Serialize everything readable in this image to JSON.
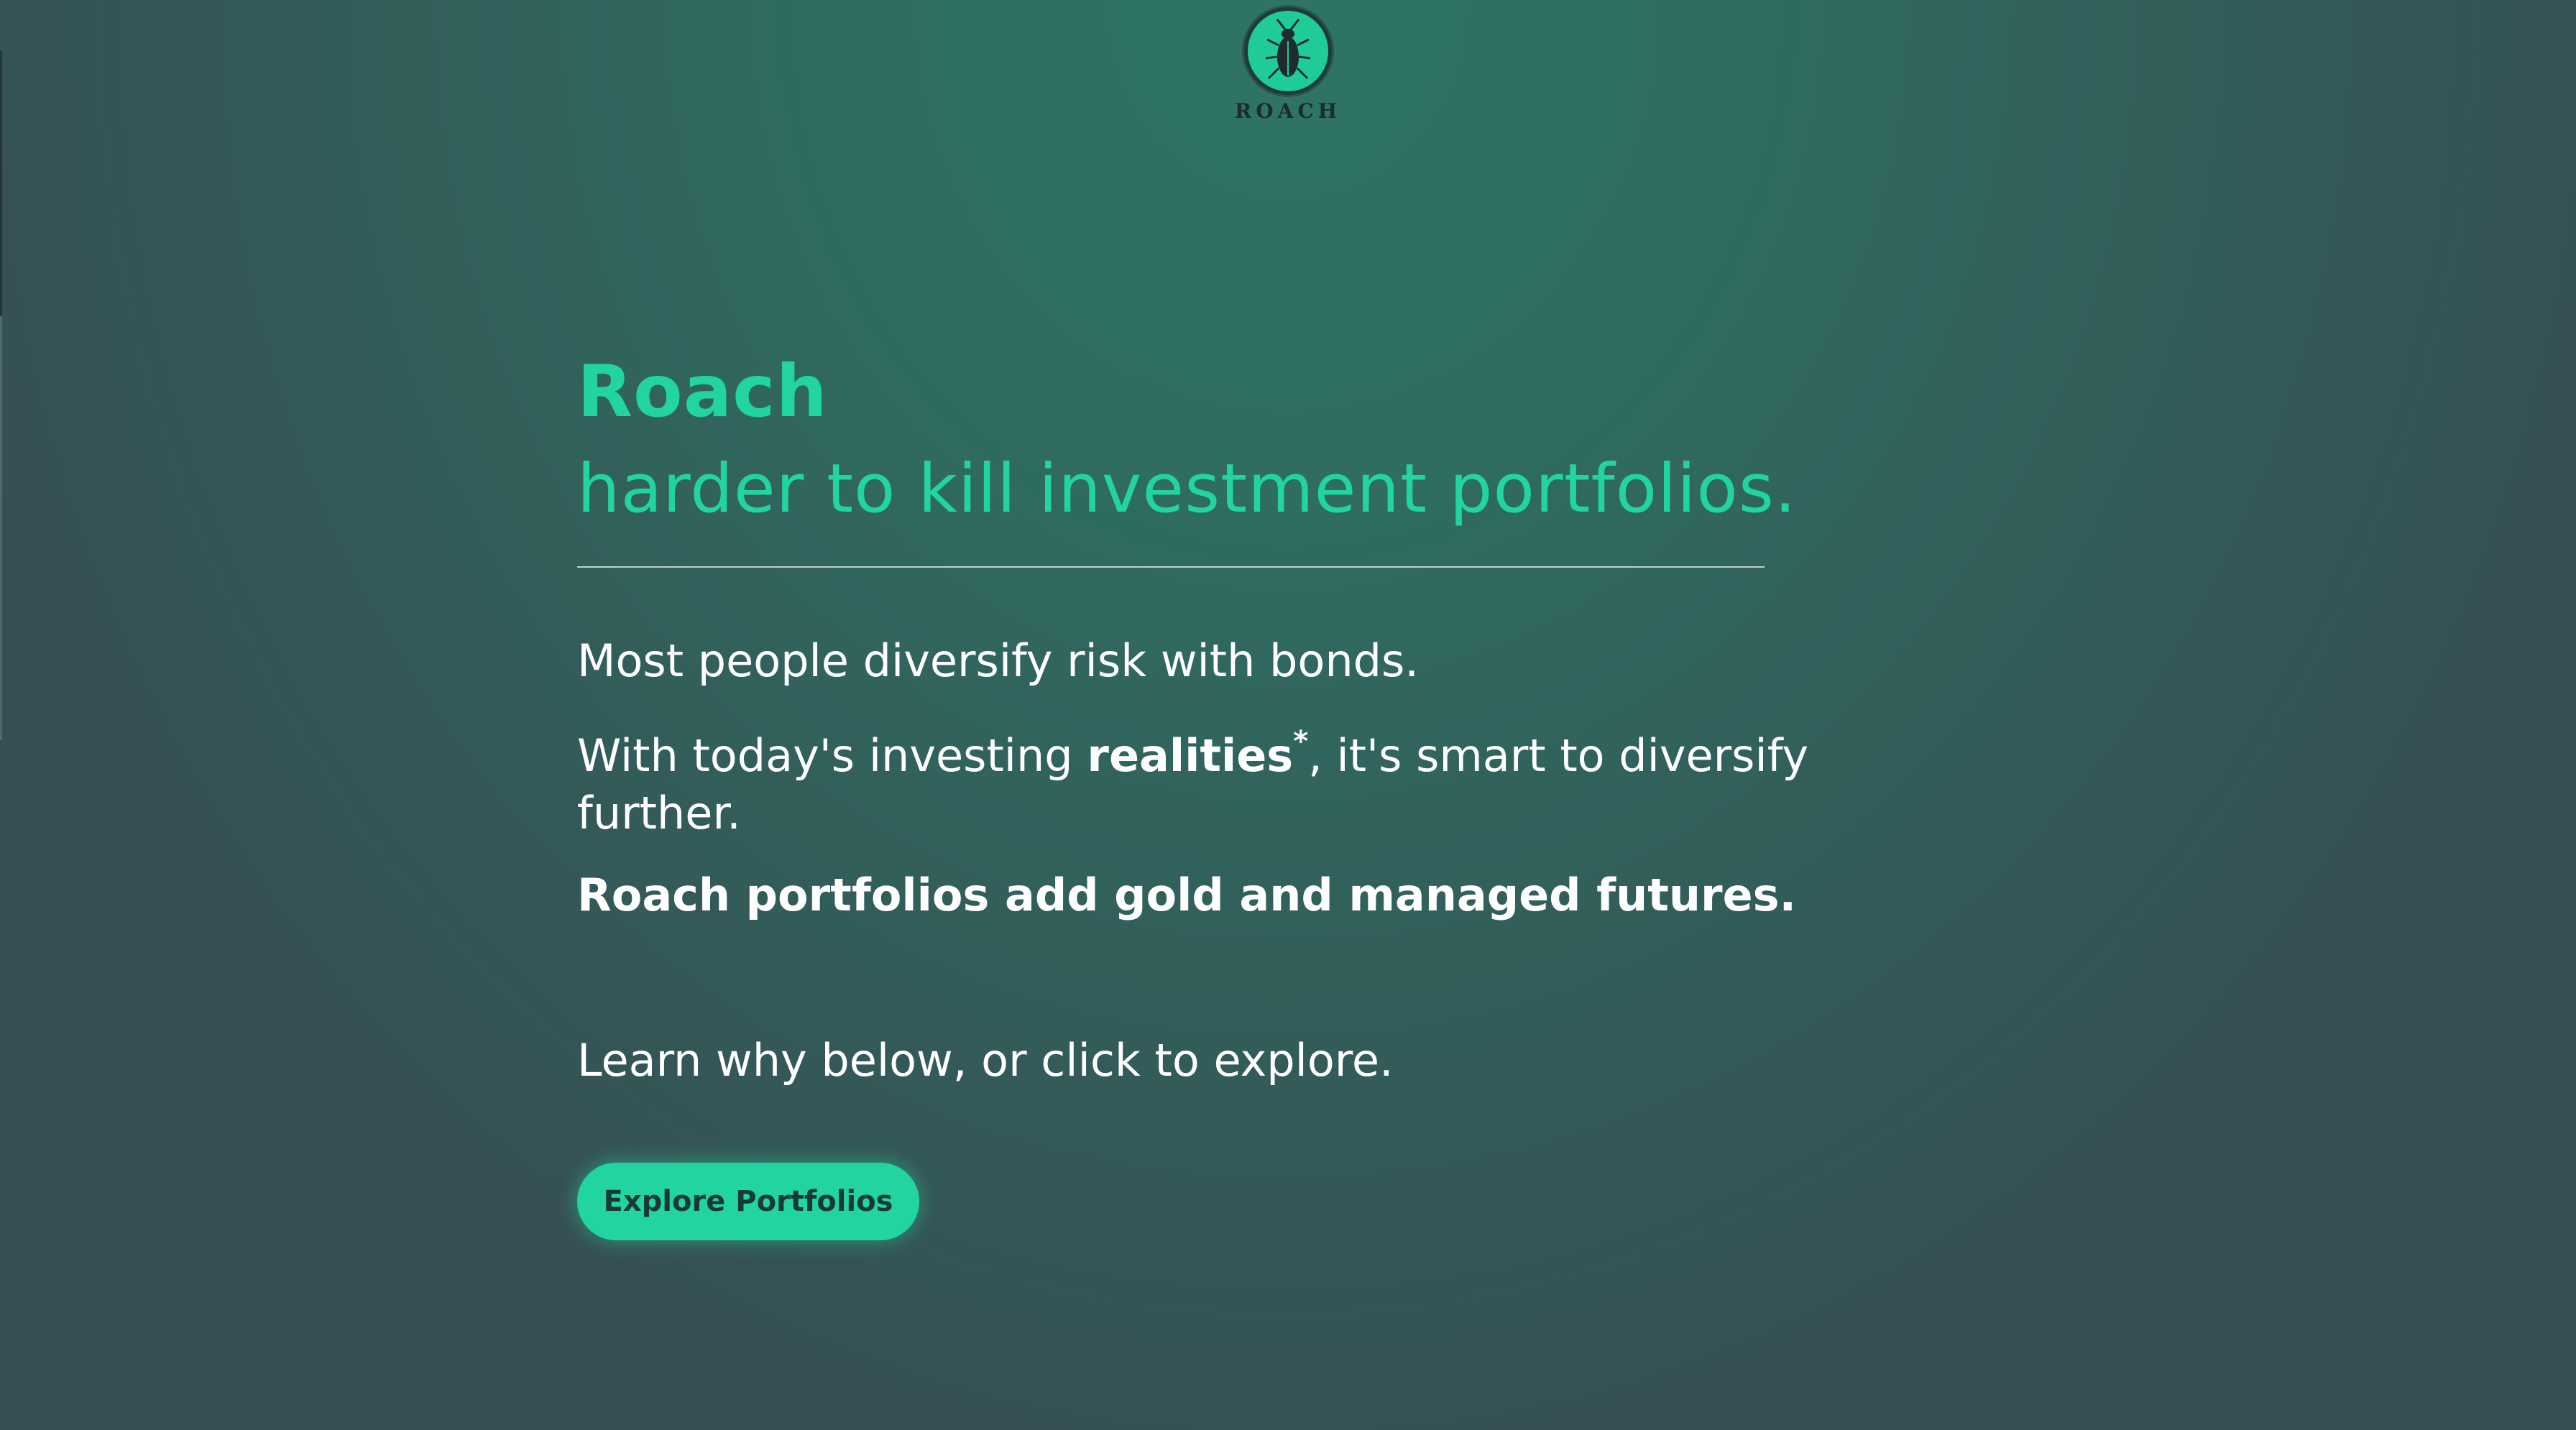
{
  "logo": {
    "icon": "roach-bug-icon",
    "text": "ROACH"
  },
  "hero": {
    "brand": "Roach",
    "tagline": "harder to kill investment portfolios."
  },
  "body": {
    "line1": "Most people diversify risk with bonds.",
    "line2_before": "With today's investing ",
    "line2_link": "realities",
    "line2_sup": "*",
    "line2_after": ", it's smart to diversify further.",
    "line3": "Roach portfolios add gold and managed futures.",
    "line4": "Learn why below, or click to explore."
  },
  "cta": {
    "label": "Explore Portfolios"
  },
  "colors": {
    "accent": "#22d49f",
    "background": "#2f6b61",
    "text": "#ffffff"
  }
}
